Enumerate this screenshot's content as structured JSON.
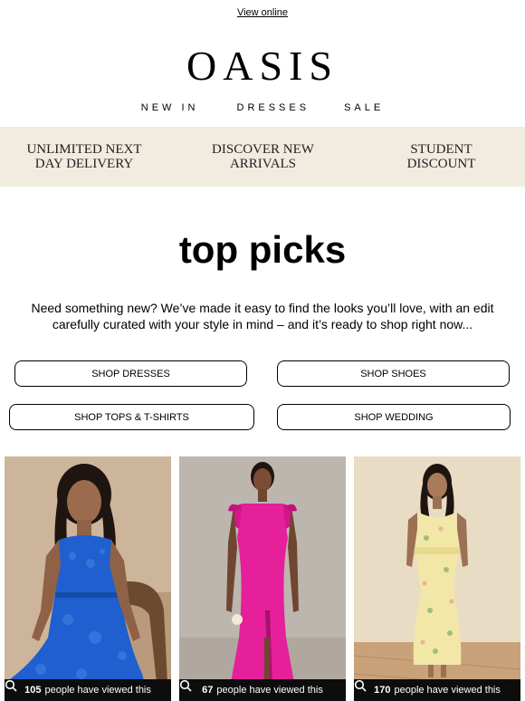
{
  "header": {
    "view_online": "View online",
    "logo": "OASIS",
    "nav": [
      "NEW IN",
      "DRESSES",
      "SALE"
    ]
  },
  "usp": [
    {
      "line1": "UNLIMITED NEXT",
      "line2": "DAY DELIVERY"
    },
    {
      "line1": "DISCOVER NEW",
      "line2": "ARRIVALS"
    },
    {
      "line1": "STUDENT",
      "line2": "DISCOUNT"
    }
  ],
  "main": {
    "title": "top picks",
    "intro": "Need something new? We’ve made it easy to find the looks you’ll love, with an edit carefully curated with your style in mind – and it’s ready to shop right now...",
    "buttons": [
      "SHOP DRESSES",
      "SHOP SHOES",
      "SHOP TOPS & T-SHIRTS",
      "SHOP WEDDING"
    ]
  },
  "products": [
    {
      "views": "105",
      "views_text": "people have viewed this",
      "dress_color": "#1f5fcf"
    },
    {
      "views": "67",
      "views_text": "people have viewed this",
      "dress_color": "#e61f9a"
    },
    {
      "views": "170",
      "views_text": "people have viewed this",
      "dress_color": "#f2e7a6"
    }
  ]
}
